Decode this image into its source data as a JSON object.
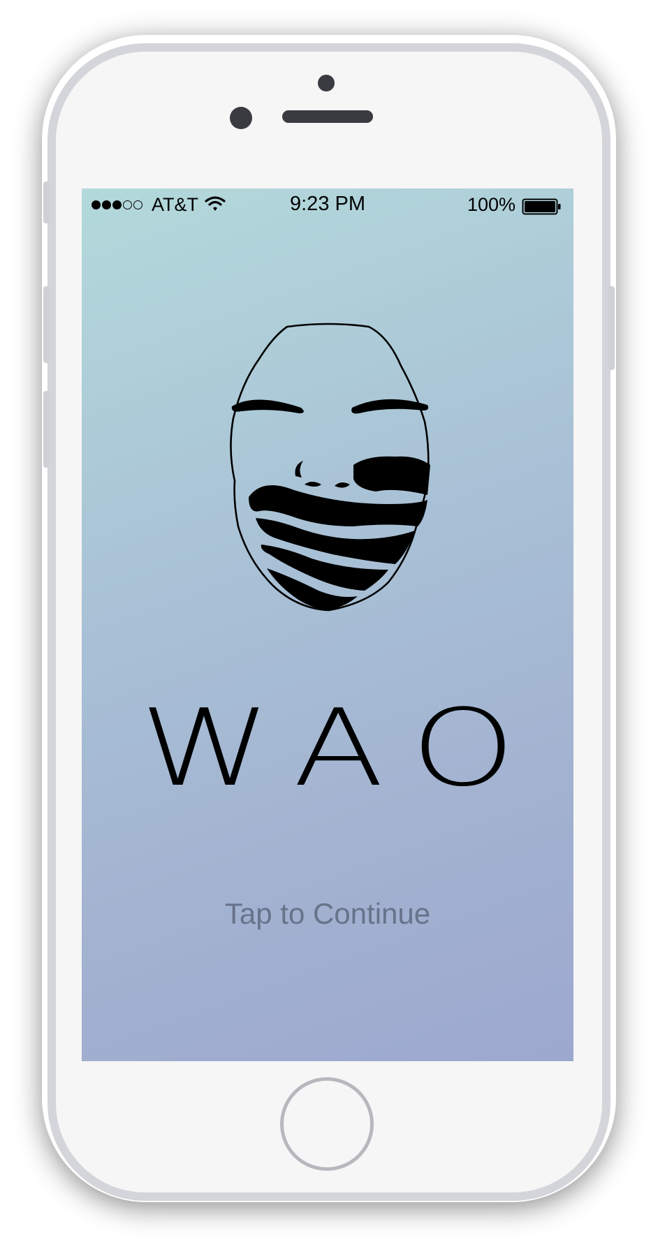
{
  "status_bar": {
    "signal_strength": "3 of 5",
    "carrier": "AT&T",
    "wifi_icon": "wifi-icon",
    "time": "9:23 PM",
    "battery_percent": "100%",
    "battery_icon": "battery-full-icon"
  },
  "splash": {
    "logo_icon": "covered-mouth-mask-icon",
    "app_name": "WAO",
    "continue_label": "Tap to Continue"
  },
  "colors": {
    "gradient_top": "#b3d9db",
    "gradient_bottom": "#9da8cf",
    "continue_text": "#66738a",
    "phone_body": "#f6f6f6"
  }
}
